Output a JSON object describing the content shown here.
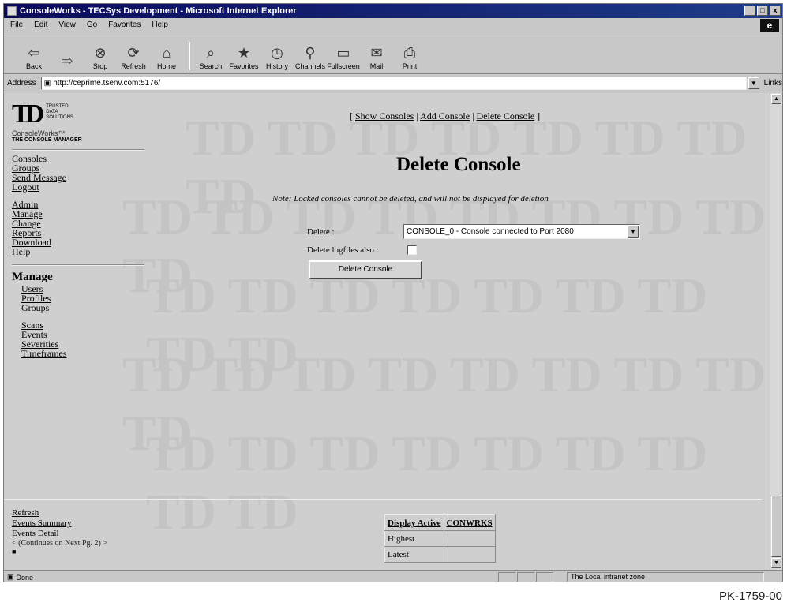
{
  "window": {
    "title": "ConsoleWorks - TECSys Development - Microsoft Internet Explorer",
    "minimize_glyph": "_",
    "maximize_glyph": "□",
    "close_glyph": "x"
  },
  "menu": [
    "File",
    "Edit",
    "View",
    "Go",
    "Favorites",
    "Help"
  ],
  "toolbar": [
    {
      "label": "Back",
      "icon": "back-icon",
      "glyph": "⇦"
    },
    {
      "label": "",
      "icon": "forward-icon",
      "glyph": "⇨"
    },
    {
      "label": "Stop",
      "icon": "stop-icon",
      "glyph": "⊗"
    },
    {
      "label": "Refresh",
      "icon": "refresh-icon",
      "glyph": "⟳"
    },
    {
      "label": "Home",
      "icon": "home-icon",
      "glyph": "⌂"
    },
    {
      "label": "Search",
      "icon": "search-icon",
      "glyph": "⌕"
    },
    {
      "label": "Favorites",
      "icon": "favorites-icon",
      "glyph": "★"
    },
    {
      "label": "History",
      "icon": "history-icon",
      "glyph": "◷"
    },
    {
      "label": "Channels",
      "icon": "channels-icon",
      "glyph": "⚲"
    },
    {
      "label": "Fullscreen",
      "icon": "fullscreen-icon",
      "glyph": "▭"
    },
    {
      "label": "Mail",
      "icon": "mail-icon",
      "glyph": "✉"
    },
    {
      "label": "Print",
      "icon": "print-icon",
      "glyph": "⎙"
    }
  ],
  "address": {
    "label": "Address",
    "url": "http://ceprime.tsenv.com:5176/",
    "links_label": "Links"
  },
  "logo": {
    "mark": "TD",
    "company_lines": [
      "TRUSTED",
      "DATA",
      "SOLUTIONS"
    ],
    "product": "ConsoleWorks™",
    "subtitle": "THE CONSOLE MANAGER"
  },
  "sidebar": {
    "group1": [
      "Consoles",
      "Groups",
      "Send Message",
      "Logout"
    ],
    "group2": [
      "Admin",
      "Manage",
      "Change",
      "Reports",
      "Download",
      "Help"
    ],
    "manage_heading": "Manage",
    "manage_group1": [
      "Users",
      "Profiles",
      "Groups"
    ],
    "manage_group2": [
      "Scans",
      "Events",
      "Severities",
      "Timeframes"
    ]
  },
  "top_nav": {
    "open": "[",
    "links": [
      "Show Consoles",
      "Add Console",
      "Delete Console"
    ],
    "divider": "|",
    "close": "]"
  },
  "page": {
    "heading": "Delete Console",
    "note": "Note: Locked consoles cannot be deleted, and will not be displayed for deletion"
  },
  "form": {
    "delete_label": "Delete :",
    "selected_console": "CONSOLE_0 - Console connected to Port 2080",
    "logfiles_label": "Delete logfiles also :",
    "logfiles_checked": false,
    "submit_label": "Delete Console"
  },
  "bottom_links": [
    "Refresh",
    "Events Summary",
    "Events Detail"
  ],
  "continued_note": "< (Continues on Next Pg. 2) >",
  "status_table": {
    "headers": [
      "Display Active",
      "CONWRKS"
    ],
    "rows": [
      [
        "Highest",
        ""
      ],
      [
        "Latest",
        ""
      ]
    ]
  },
  "statusbar": {
    "text": "Done",
    "zone": "The Local intranet zone"
  },
  "caption": "PK-1759-00"
}
